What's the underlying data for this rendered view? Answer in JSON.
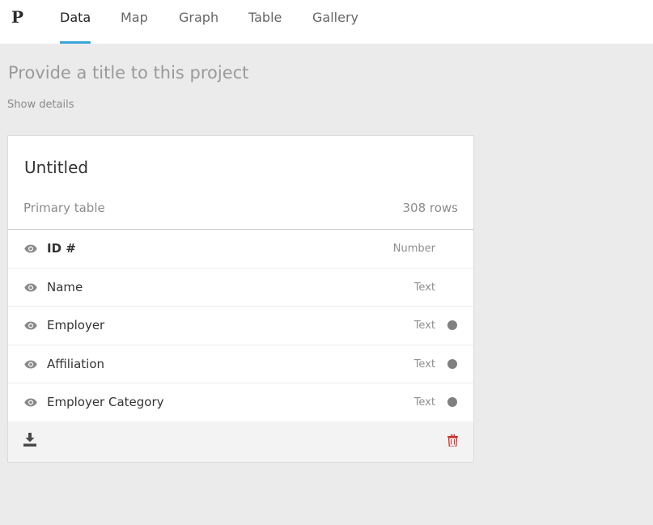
{
  "app": {
    "logo": "P"
  },
  "nav": {
    "tabs": [
      {
        "label": "Data",
        "active": true
      },
      {
        "label": "Map"
      },
      {
        "label": "Graph"
      },
      {
        "label": "Table"
      },
      {
        "label": "Gallery"
      }
    ]
  },
  "project": {
    "title_placeholder": "Provide a title to this project",
    "show_details": "Show details"
  },
  "card": {
    "title": "Untitled",
    "primary_label": "Primary table",
    "rows": "308 rows",
    "fields": [
      {
        "name": "ID #",
        "type": "Number",
        "icon": "eye-icon"
      },
      {
        "name": "Name",
        "type": "Text",
        "icon": "eye-icon"
      },
      {
        "name": "Employer",
        "type": "Text",
        "icon": "eye-icon",
        "has_dot": true
      },
      {
        "name": "Affiliation",
        "type": "Text",
        "icon": "eye-icon",
        "has_dot": true
      },
      {
        "name": "Employer Category",
        "type": "Text",
        "icon": "eye-icon",
        "has_dot": true
      }
    ],
    "footer": {
      "download_icon": "download-icon",
      "delete_icon": "trash-icon"
    }
  },
  "colors": {
    "accent": "#3aa6d8",
    "background": "#ebebeb",
    "delete": "#d0312d"
  }
}
